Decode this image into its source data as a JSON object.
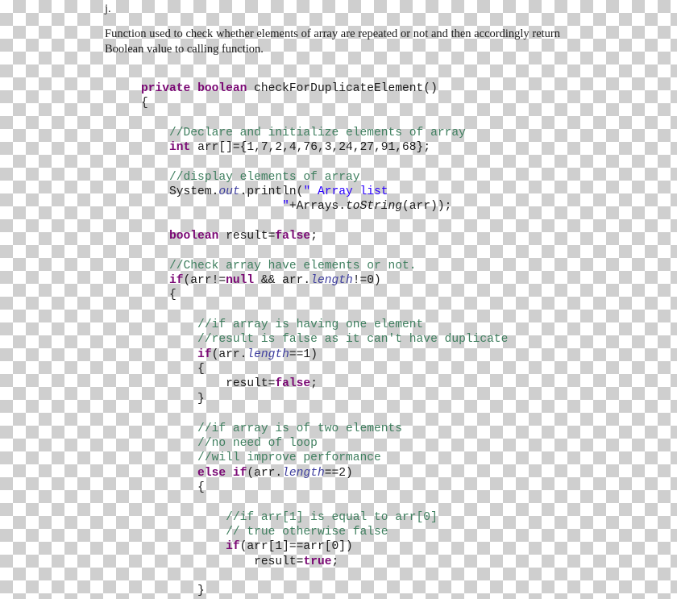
{
  "document": {
    "label": "j.",
    "description": "Function used to check whether elements of array are repeated or not and then accordingly return Boolean value to calling function.",
    "code_lines": [
      {
        "indent": 0,
        "tokens": [
          {
            "t": "private ",
            "c": "kw"
          },
          {
            "t": "boolean ",
            "c": "kw"
          },
          {
            "t": "checkForDuplicateElement()",
            "c": "plain"
          }
        ]
      },
      {
        "indent": 0,
        "tokens": [
          {
            "t": "{",
            "c": "plain"
          }
        ]
      },
      {
        "indent": 0,
        "tokens": []
      },
      {
        "indent": 0,
        "tokens": [
          {
            "t": "    //Declare and initialize elements of array",
            "c": "cmt"
          }
        ]
      },
      {
        "indent": 0,
        "tokens": [
          {
            "t": "    int",
            "c": "kw"
          },
          {
            "t": " arr[]={1,7,2,4,76,3,24,27,91,68};",
            "c": "plain"
          }
        ]
      },
      {
        "indent": 0,
        "tokens": []
      },
      {
        "indent": 0,
        "tokens": [
          {
            "t": "    //display elements of array",
            "c": "cmt"
          }
        ]
      },
      {
        "indent": 0,
        "tokens": [
          {
            "t": "    System.",
            "c": "plain"
          },
          {
            "t": "out",
            "c": "fld"
          },
          {
            "t": ".println(",
            "c": "plain"
          },
          {
            "t": "\" Array list",
            "c": "str"
          }
        ]
      },
      {
        "indent": 0,
        "tokens": [
          {
            "t": "                    \"",
            "c": "str"
          },
          {
            "t": "+Arrays.",
            "c": "plain"
          },
          {
            "t": "toString",
            "c": "mth"
          },
          {
            "t": "(arr));",
            "c": "plain"
          }
        ]
      },
      {
        "indent": 0,
        "tokens": []
      },
      {
        "indent": 0,
        "tokens": [
          {
            "t": "    boolean",
            "c": "kw"
          },
          {
            "t": " result=",
            "c": "plain"
          },
          {
            "t": "false",
            "c": "kw"
          },
          {
            "t": ";",
            "c": "plain"
          }
        ]
      },
      {
        "indent": 0,
        "tokens": []
      },
      {
        "indent": 0,
        "tokens": [
          {
            "t": "    //Check array have elements or not.",
            "c": "cmt"
          }
        ]
      },
      {
        "indent": 0,
        "tokens": [
          {
            "t": "    if",
            "c": "kw"
          },
          {
            "t": "(arr!=",
            "c": "plain"
          },
          {
            "t": "null",
            "c": "kw"
          },
          {
            "t": " && arr.",
            "c": "plain"
          },
          {
            "t": "length",
            "c": "fld"
          },
          {
            "t": "!=0)",
            "c": "plain"
          }
        ]
      },
      {
        "indent": 0,
        "tokens": [
          {
            "t": "    {",
            "c": "plain"
          }
        ]
      },
      {
        "indent": 0,
        "tokens": []
      },
      {
        "indent": 0,
        "tokens": [
          {
            "t": "        //if array is having one element",
            "c": "cmt"
          }
        ]
      },
      {
        "indent": 0,
        "tokens": [
          {
            "t": "        //result is false as it can't have duplicate",
            "c": "cmt"
          }
        ]
      },
      {
        "indent": 0,
        "tokens": [
          {
            "t": "        if",
            "c": "kw"
          },
          {
            "t": "(arr.",
            "c": "plain"
          },
          {
            "t": "length",
            "c": "fld"
          },
          {
            "t": "==1)",
            "c": "plain"
          }
        ]
      },
      {
        "indent": 0,
        "tokens": [
          {
            "t": "        {",
            "c": "plain"
          }
        ]
      },
      {
        "indent": 0,
        "tokens": [
          {
            "t": "            result=",
            "c": "plain"
          },
          {
            "t": "false",
            "c": "kw"
          },
          {
            "t": ";",
            "c": "plain"
          }
        ]
      },
      {
        "indent": 0,
        "tokens": [
          {
            "t": "        }",
            "c": "plain"
          }
        ]
      },
      {
        "indent": 0,
        "tokens": []
      },
      {
        "indent": 0,
        "tokens": [
          {
            "t": "        //if array is of two elements",
            "c": "cmt"
          }
        ]
      },
      {
        "indent": 0,
        "tokens": [
          {
            "t": "        //no need of loop",
            "c": "cmt"
          }
        ]
      },
      {
        "indent": 0,
        "tokens": [
          {
            "t": "        //will improve performance",
            "c": "cmt"
          }
        ]
      },
      {
        "indent": 0,
        "tokens": [
          {
            "t": "        else if",
            "c": "kw"
          },
          {
            "t": "(arr.",
            "c": "plain"
          },
          {
            "t": "length",
            "c": "fld"
          },
          {
            "t": "==2)",
            "c": "plain"
          }
        ]
      },
      {
        "indent": 0,
        "tokens": [
          {
            "t": "        {",
            "c": "plain"
          }
        ]
      },
      {
        "indent": 0,
        "tokens": []
      },
      {
        "indent": 0,
        "tokens": [
          {
            "t": "            //if arr[1] is equal to arr[0]",
            "c": "cmt"
          }
        ]
      },
      {
        "indent": 0,
        "tokens": [
          {
            "t": "            // true otherwise false",
            "c": "cmt"
          }
        ]
      },
      {
        "indent": 0,
        "tokens": [
          {
            "t": "            if",
            "c": "kw"
          },
          {
            "t": "(arr[1]==arr[0])",
            "c": "plain"
          }
        ]
      },
      {
        "indent": 0,
        "tokens": [
          {
            "t": "                result=",
            "c": "plain"
          },
          {
            "t": "true",
            "c": "kw"
          },
          {
            "t": ";",
            "c": "plain"
          }
        ]
      },
      {
        "indent": 0,
        "tokens": []
      },
      {
        "indent": 0,
        "tokens": [
          {
            "t": "        }",
            "c": "plain"
          }
        ]
      }
    ]
  }
}
